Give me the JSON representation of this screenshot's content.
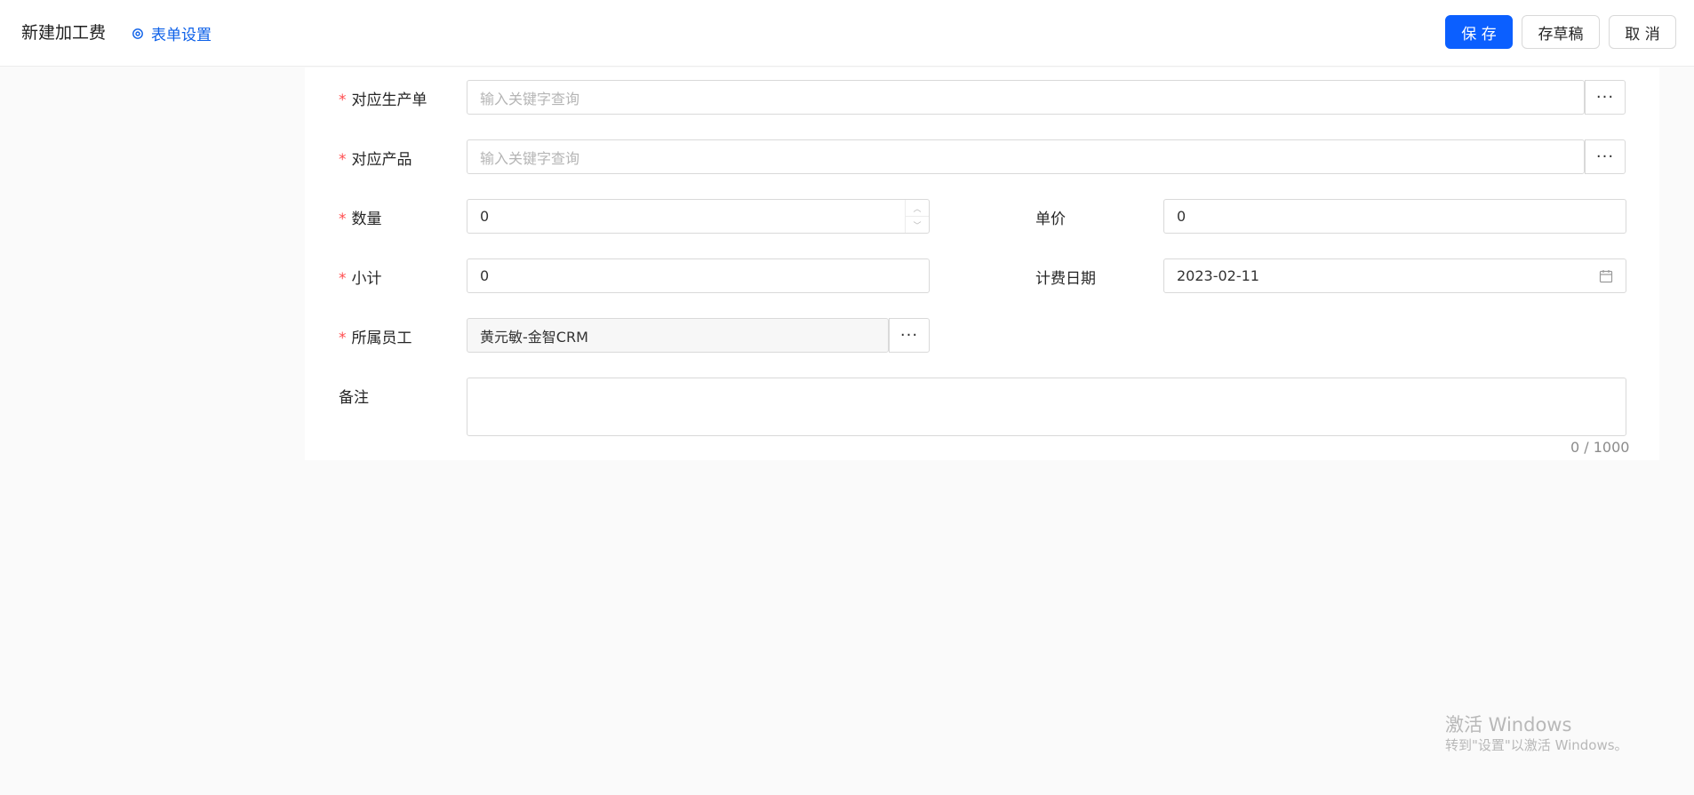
{
  "header": {
    "title": "新建加工费",
    "form_settings_label": "表单设置",
    "save_label": "保 存",
    "draft_label": "存草稿",
    "cancel_label": "取 消"
  },
  "form": {
    "production_order": {
      "label": "对应生产单",
      "required": "*",
      "placeholder": "输入关键字查询",
      "more": "···"
    },
    "product": {
      "label": "对应产品",
      "required": "*",
      "placeholder": "输入关键字查询",
      "more": "···"
    },
    "quantity": {
      "label": "数量",
      "required": "*",
      "value": "0"
    },
    "unit_price": {
      "label": "单价",
      "value": "0"
    },
    "subtotal": {
      "label": "小计",
      "required": "*",
      "value": "0"
    },
    "billing_date": {
      "label": "计费日期",
      "value": "2023-02-11"
    },
    "employee": {
      "label": "所属员工",
      "required": "*",
      "value": "黄元敏-金智CRM",
      "more": "···"
    },
    "remark": {
      "label": "备注",
      "value": "",
      "counter": "0 / 1000"
    }
  },
  "watermark": {
    "line1": "激活 Windows",
    "line2": "转到\"设置\"以激活 Windows。"
  },
  "colors": {
    "primary": "#0b5fff",
    "link": "#0b5fe8",
    "required": "#ff4d4f"
  }
}
